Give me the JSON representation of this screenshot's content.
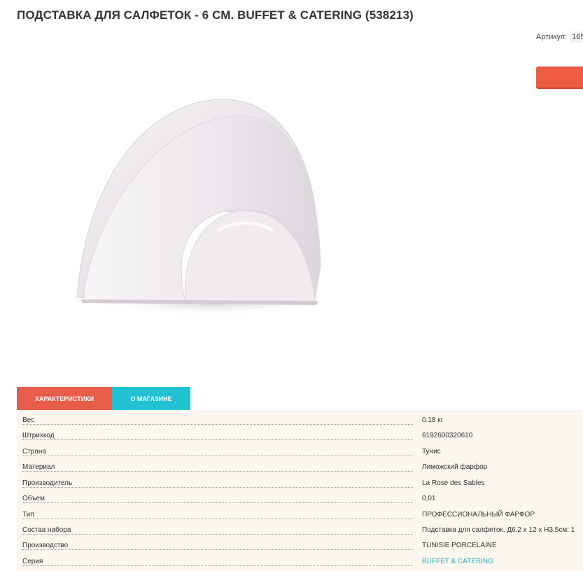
{
  "product": {
    "title": "ПОДСТАВКА ДЛЯ САЛФЕТОК - 6 СМ. BUFFET & CATERING (538213)",
    "article_label": "Артикул:",
    "article_value": "165"
  },
  "tabs": [
    {
      "label": "ХАРАКТЕРИСТИКИ",
      "active": true,
      "color": "#e85c4a"
    },
    {
      "label": "О МАГАЗИНЕ",
      "active": false,
      "color": "#21c3d3"
    }
  ],
  "specs": [
    {
      "name": "Вес",
      "value": "0.18 кг"
    },
    {
      "name": "Штрихкод",
      "value": "6192600320610"
    },
    {
      "name": "Страна",
      "value": "Тунис"
    },
    {
      "name": "Материал",
      "value": "Лиможский фарфор"
    },
    {
      "name": "Производитель",
      "value": "La Rose des Sables"
    },
    {
      "name": "Объем",
      "value": "0,01"
    },
    {
      "name": "Тип",
      "value": "ПРОФЕССИОНАЛЬНЫЙ ФАРФОР"
    },
    {
      "name": "Состав набора",
      "value": "Подставка для салфеток, Д6,2 х 12 х Н3,5см: 1"
    },
    {
      "name": "Производство",
      "value": "TUNISIE PORCELAINE"
    },
    {
      "name": "Серия",
      "value": "BUFFET & CATERING"
    }
  ],
  "colors": {
    "accent_red": "#ed5b45",
    "accent_cyan": "#21c3d3",
    "link": "#21b2c4",
    "specs_background": "#fbf6ee"
  }
}
